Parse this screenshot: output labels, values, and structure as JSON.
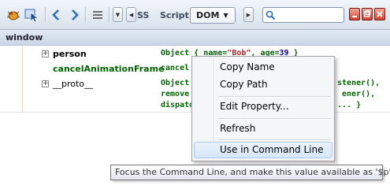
{
  "toolbar": {
    "tab_partial": "SS",
    "tab_script": "Script",
    "tab_dom": "DOM",
    "search": {
      "value": "",
      "placeholder": ""
    }
  },
  "window_header": "window",
  "rows": [
    {
      "name": "person",
      "value_prefix": "Object { ",
      "key1": "name=",
      "str1": "\"Bob\"",
      "key2": ",  age=",
      "num2": "39",
      "suffix": " }"
    },
    {
      "name": "cancelAnimationFrame",
      "value": "cancel"
    },
    {
      "name": "__proto__",
      "value_line1": "Object",
      "value_line1_right": "stener(),",
      "value_line2": "remove",
      "value_line2_right": "ener(),",
      "value_line3": "dispato",
      "value_line3_right": "... }"
    }
  ],
  "menu": {
    "items": [
      {
        "label": "Copy Name"
      },
      {
        "label": "Copy Path"
      },
      {
        "label": "Edit Property..."
      },
      {
        "label": "Refresh"
      },
      {
        "label": "Use in Command Line"
      }
    ]
  },
  "tooltip": "Focus the Command Line, and make this value available as '$p'",
  "colors": {
    "accent_blue": "#2b6cc4",
    "value_green": "#006400",
    "string_red": "#b22222",
    "menu_hover": "#d6e7f9"
  }
}
